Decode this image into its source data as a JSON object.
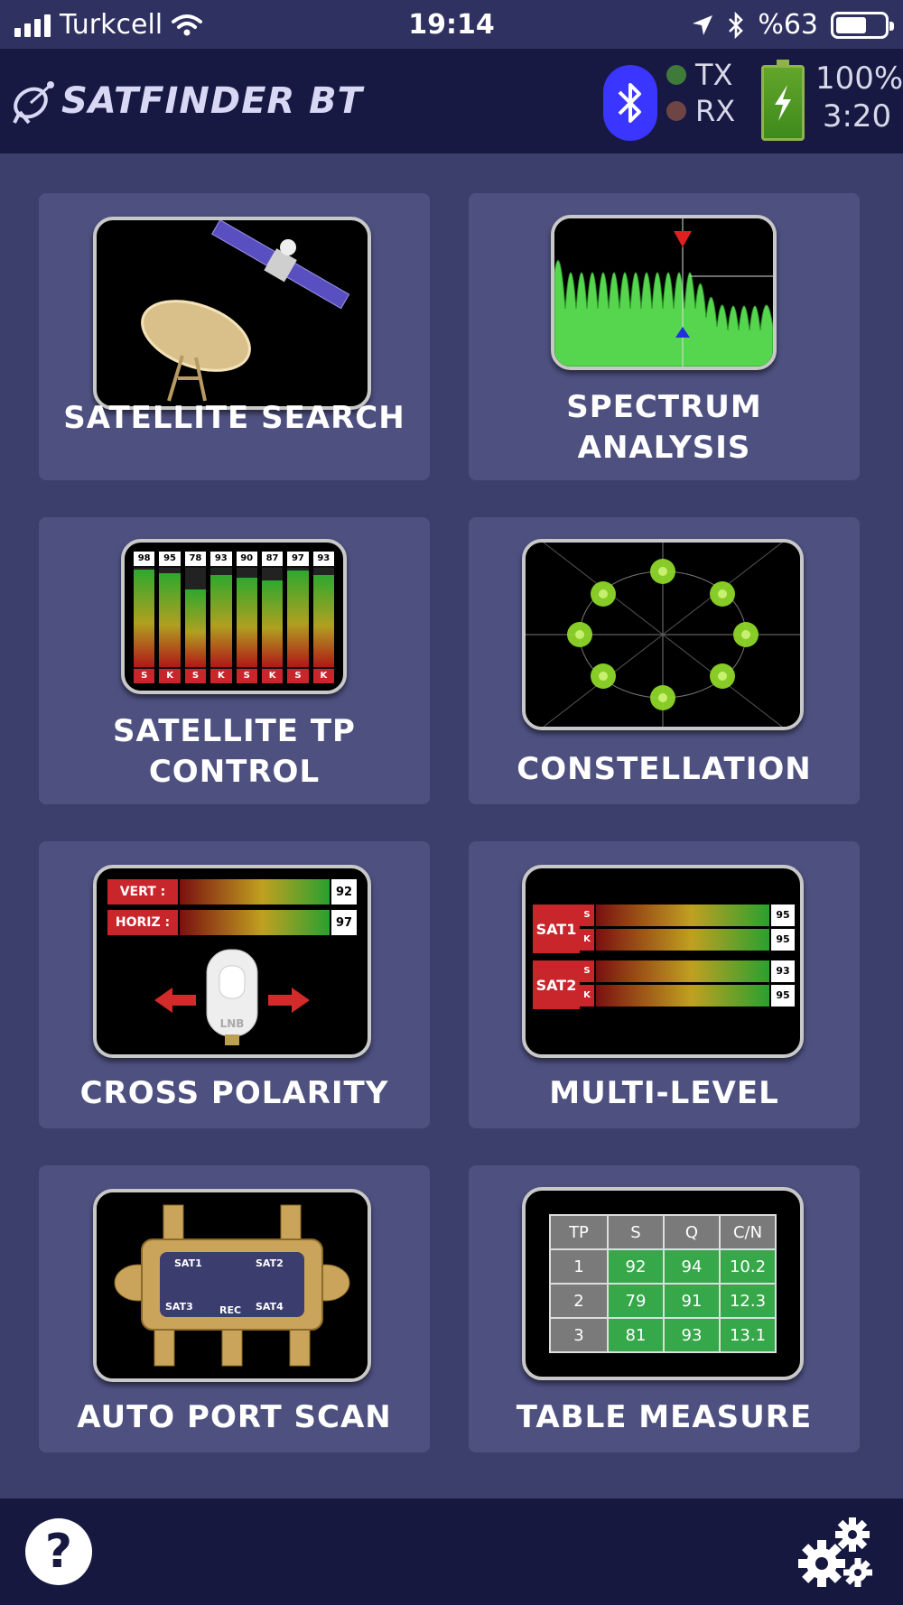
{
  "status_bar": {
    "carrier": "Turkcell",
    "time": "19:14",
    "battery_percent": "%63",
    "battery_level": 0.63
  },
  "header": {
    "app_title": "SATFINDER BT",
    "tx_label": "TX",
    "rx_label": "RX",
    "tx_color": "#3f7a3a",
    "rx_color": "#6e4444",
    "bluetooth_color": "#3a36ff",
    "battery_percent": "100%",
    "battery_time": "3:20"
  },
  "menu": {
    "satellite_search": "SATELLITE SEARCH",
    "spectrum_analysis_1": "SPECTRUM",
    "spectrum_analysis_2": "ANALYSIS",
    "tp_control_1": "SATELLITE TP",
    "tp_control_2": "CONTROL",
    "constellation": "CONSTELLATION",
    "cross_polarity": "CROSS POLARITY",
    "multi_level": "MULTI-LEVEL",
    "auto_port_scan": "AUTO PORT SCAN",
    "table_measure": "TABLE MEASURE"
  },
  "tp_bars": {
    "values": [
      "98",
      "95",
      "78",
      "93",
      "90",
      "87",
      "97",
      "93"
    ],
    "labels": [
      "S",
      "K",
      "S",
      "K",
      "S",
      "K",
      "S",
      "K"
    ]
  },
  "cross_polarity_preview": {
    "vert_label": "VERT :",
    "vert_value": "92",
    "horiz_label": "HORIZ :",
    "horiz_value": "97",
    "lnb_label": "LNB"
  },
  "multi_level_preview": {
    "sat1": "SAT1",
    "sat2": "SAT2",
    "rows": [
      {
        "tag": "S",
        "value": "95"
      },
      {
        "tag": "K",
        "value": "95"
      },
      {
        "tag": "S",
        "value": "93"
      },
      {
        "tag": "K",
        "value": "95"
      }
    ]
  },
  "port_scan_preview": {
    "sat1": "SAT1",
    "sat2": "SAT2",
    "sat3": "SAT3",
    "sat4": "SAT4",
    "rec": "REC"
  },
  "table_preview": {
    "headers": [
      "TP",
      "S",
      "Q",
      "C/N"
    ],
    "rows": [
      [
        "1",
        "92",
        "94",
        "10.2"
      ],
      [
        "2",
        "79",
        "91",
        "12.3"
      ],
      [
        "3",
        "81",
        "93",
        "13.1"
      ]
    ]
  },
  "footer": {
    "help_label": "?"
  },
  "icons": {
    "bluetooth": "bluetooth-icon",
    "settings": "gears-icon",
    "help": "help-icon"
  }
}
